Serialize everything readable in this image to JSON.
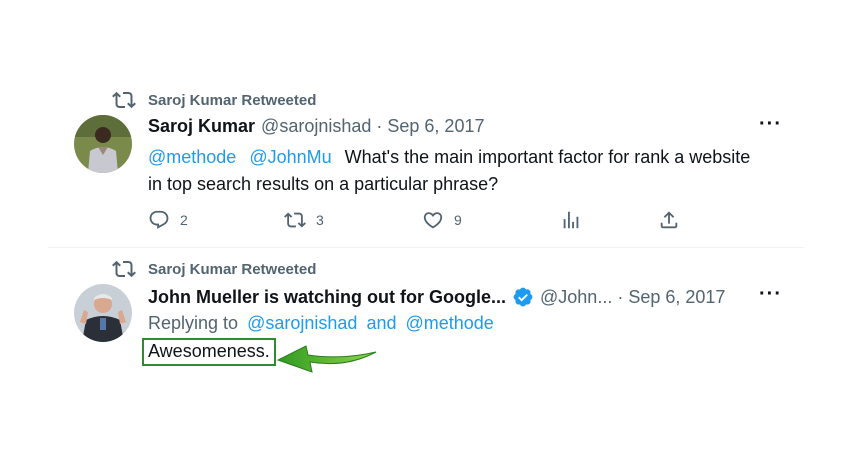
{
  "tweet1": {
    "retweet_label": "Saroj Kumar Retweeted",
    "author_name": "Saroj Kumar",
    "handle": "@sarojnishad",
    "separator": "·",
    "date": "Sep 6, 2017",
    "more": "···",
    "mention1": "@methode",
    "mention2": "@JohnMu",
    "text_line1": "What's the main important factor for rank a  website",
    "text_line2": "in top search results on a particular phrase?",
    "reply_count": "2",
    "retweet_count": "3",
    "like_count": "9"
  },
  "tweet2": {
    "retweet_label": "Saroj Kumar Retweeted",
    "author_name": "John Mueller is watching out for Google...",
    "handle": "@John...",
    "separator": "·",
    "date": "Sep 6, 2017",
    "more": "···",
    "replying_prefix": "Replying to",
    "reply_to1": "@sarojnishad",
    "reply_and": "and",
    "reply_to2": "@methode",
    "text": "Awesomeness."
  },
  "colors": {
    "accent": "#1d9bf0",
    "muted": "#536471",
    "highlight": "#2e8b2e",
    "arrow": "#4caf2a"
  }
}
